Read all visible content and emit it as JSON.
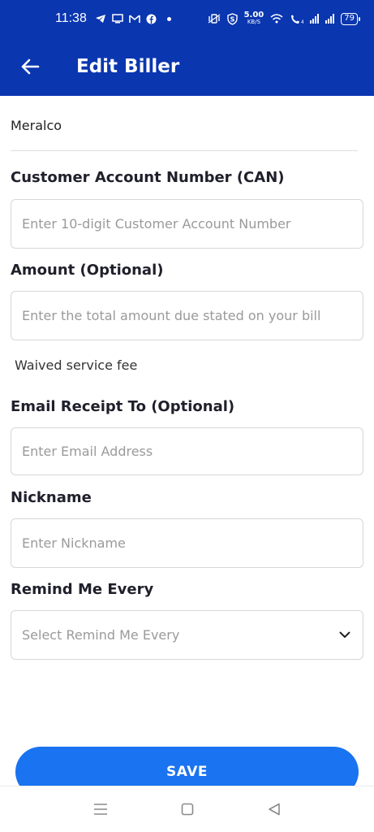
{
  "status_bar": {
    "time": "11:38",
    "speed_value": "5.00",
    "speed_unit": "KB/S",
    "battery": "79"
  },
  "header": {
    "title": "Edit Biller"
  },
  "biller": {
    "name": "Meralco"
  },
  "form": {
    "can": {
      "label": "Customer Account Number (CAN)",
      "placeholder": "Enter 10-digit Customer Account Number",
      "value": ""
    },
    "amount": {
      "label": "Amount (Optional)",
      "placeholder": "Enter the total amount due stated on your bill",
      "value": "",
      "note": "Waived service fee"
    },
    "email": {
      "label": "Email Receipt To (Optional)",
      "placeholder": "Enter Email Address",
      "value": ""
    },
    "nickname": {
      "label": "Nickname",
      "placeholder": "Enter Nickname",
      "value": ""
    },
    "remind": {
      "label": "Remind Me Every",
      "placeholder": "Select Remind Me Every"
    }
  },
  "actions": {
    "save_label": "SAVE"
  },
  "colors": {
    "header_bg": "#0a36b0",
    "button_bg": "#1a73f0"
  }
}
